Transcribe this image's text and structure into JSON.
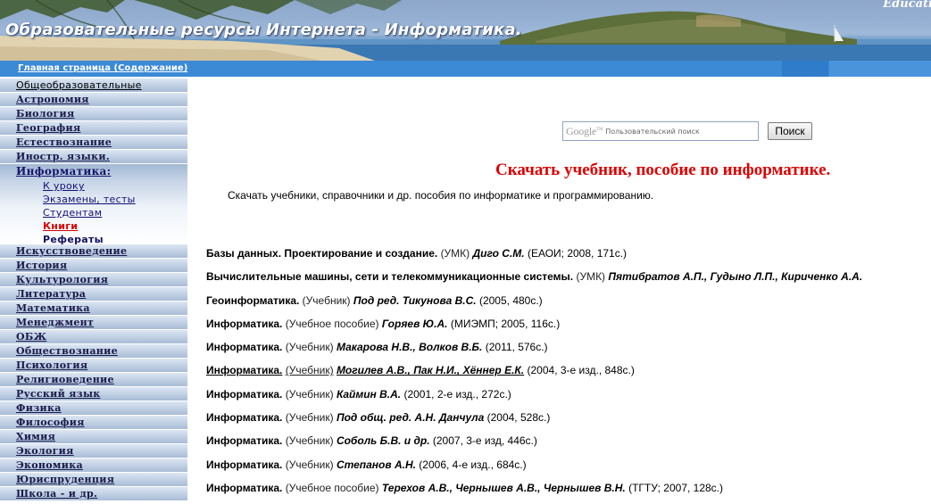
{
  "header": {
    "title": "Образовательные ресурсы Интернета - Информатика.",
    "corner_word": "Educati"
  },
  "nav": {
    "home_link": "Главная страница (Содержание)"
  },
  "sidebar": {
    "categories": [
      "Общеобразовательные",
      "Астрономия",
      "Биология",
      "География",
      "Естествознание",
      "Иностр. языки."
    ],
    "active": {
      "label": "Информатика:",
      "subitems": [
        "К уроку",
        "Экзамены, тесты",
        "Студентам",
        "Книги",
        "Рефераты"
      ]
    },
    "categories_after": [
      "Искусствоведение",
      "История",
      "Культурология",
      "Литература",
      "Математика",
      "Менеджмент",
      "ОБЖ",
      "Обществознание",
      "Психология",
      "Религиоведение",
      "Русский язык",
      "Физика",
      "Философия",
      "Химия",
      "Экология",
      "Экономика",
      "Юриспруденция",
      "Школа - и др."
    ]
  },
  "search": {
    "logo_text": "Google",
    "placeholder": "Пользовательский поиск",
    "button_label": "Поиск"
  },
  "main": {
    "heading": "Скачать учебник, пособие по информатике.",
    "intro": "Скачать учебники, справочники и др. пособия по информатике и программированию.",
    "books": [
      {
        "title": "Базы данных. Проектирование и создание.",
        "kind": "(УМК)",
        "authors": "Диго С.М.",
        "pub": "(ЕАОИ; 2008, 171с.)"
      },
      {
        "title": "Вычислительные машины, сети и телекоммуникационные системы.",
        "kind": "(УМК)",
        "authors": "Пятибратов А.П., Гудыно Л.П., Кириченко А.А.",
        "pub": ""
      },
      {
        "title": "Геоинформатика.",
        "kind": "(Учебник)",
        "authors": "Под ред. Тикунова В.С.",
        "pub": "(2005, 480с.)"
      },
      {
        "title": "Информатика.",
        "kind": "(Учебное пособие)",
        "authors": "Горяев Ю.А.",
        "pub": "(МИЭМП; 2005, 116с.)"
      },
      {
        "title": "Информатика.",
        "kind": "(Учебник)",
        "authors": "Макарова Н.В., Волков В.Б.",
        "pub": "(2011, 576с.)"
      },
      {
        "title": "Информатика.",
        "kind": "(Учебник)",
        "authors": "Могилев А.В., Пак Н.И., Хённер Е.К.",
        "pub": "(2004, 3-е изд., 848с.)"
      },
      {
        "title": "Информатика.",
        "kind": "(Учебник)",
        "authors": "Каймин В.А.",
        "pub": "(2001, 2-е изд., 272с.)"
      },
      {
        "title": "Информатика.",
        "kind": "(Учебник)",
        "authors": "Под общ. ред. А.Н. Данчула",
        "pub": "(2004, 528с.)"
      },
      {
        "title": "Информатика.",
        "kind": "(Учебник)",
        "authors": "Соболь Б.В. и др.",
        "pub": "(2007, 3-е изд, 446с.)"
      },
      {
        "title": "Информатика.",
        "kind": "(Учебник)",
        "authors": "Степанов А.Н.",
        "pub": "(2006, 4-е изд., 684с.)"
      },
      {
        "title": "Информатика.",
        "kind": "(Учебное пособие)",
        "authors": "Терехов А.В., Чернышев А.В., Чернышев В.Н.",
        "pub": "(ТГТУ; 2007, 128с.)"
      }
    ]
  },
  "colors": {
    "heading": "#dd0000",
    "nav_bar": "#3c8ad6",
    "sidebar_item": "#c4d3e6",
    "link": "#111177"
  }
}
